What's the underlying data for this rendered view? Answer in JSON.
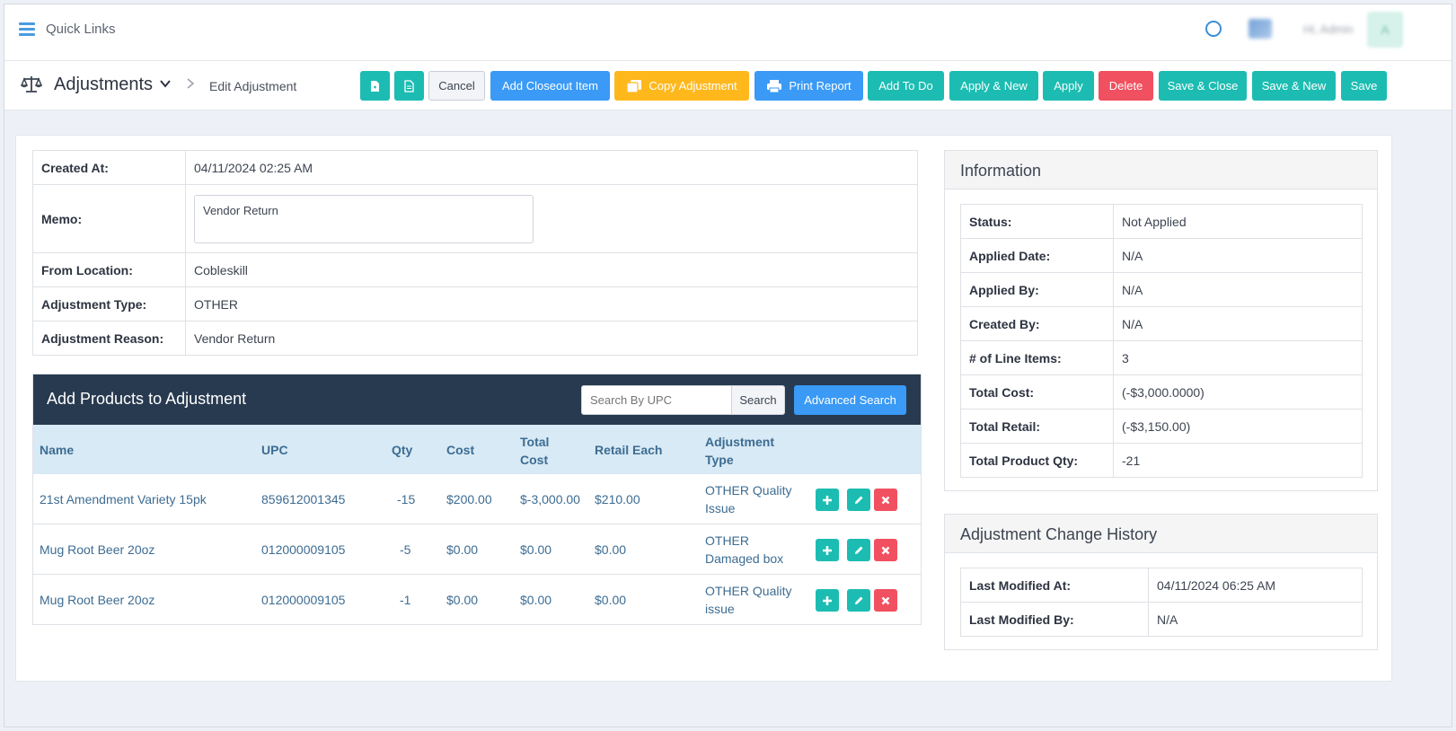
{
  "header": {
    "quick_links": "Quick Links",
    "user_label": "Hi, Admin",
    "avatar_initial": "A"
  },
  "toolbar": {
    "page_title": "Adjustments",
    "breadcrumb": "Edit Adjustment",
    "buttons": {
      "cancel": "Cancel",
      "add_closeout": "Add Closeout Item",
      "copy_adjustment": "Copy Adjustment",
      "print_report": "Print Report",
      "add_todo": "Add To Do",
      "apply_new": "Apply & New",
      "apply": "Apply",
      "delete": "Delete",
      "save_close": "Save & Close",
      "save_new": "Save & New",
      "save": "Save"
    }
  },
  "details": {
    "created_at_label": "Created At:",
    "created_at": "04/11/2024 02:25 AM",
    "memo_label": "Memo:",
    "memo": "Vendor Return",
    "from_location_label": "From Location:",
    "from_location": "Cobleskill",
    "adjustment_type_label": "Adjustment Type:",
    "adjustment_type": "OTHER",
    "adjustment_reason_label": "Adjustment Reason:",
    "adjustment_reason": "Vendor Return"
  },
  "products": {
    "title": "Add Products to Adjustment",
    "search_placeholder": "Search By UPC",
    "search_button": "Search",
    "advanced_search": "Advanced Search",
    "columns": [
      "Name",
      "UPC",
      "Qty",
      "Cost",
      "Total Cost",
      "Retail Each",
      "Adjustment Type"
    ],
    "rows": [
      {
        "name": "21st Amendment Variety 15pk",
        "upc": "859612001345",
        "qty": "-15",
        "cost": "$200.00",
        "total_cost": "$-3,000.00",
        "retail": "$210.00",
        "type1": "OTHER Quality",
        "type2": "Issue"
      },
      {
        "name": "Mug Root Beer 20oz",
        "upc": "012000009105",
        "qty": "-5",
        "cost": "$0.00",
        "total_cost": "$0.00",
        "retail": "$0.00",
        "type1": "OTHER",
        "type2": "Damaged box"
      },
      {
        "name": "Mug Root Beer 20oz",
        "upc": "012000009105",
        "qty": "-1",
        "cost": "$0.00",
        "total_cost": "$0.00",
        "retail": "$0.00",
        "type1": "OTHER Quality",
        "type2": "issue"
      }
    ]
  },
  "information": {
    "title": "Information",
    "status_label": "Status:",
    "status": "Not Applied",
    "applied_date_label": "Applied Date:",
    "applied_date": "N/A",
    "applied_by_label": "Applied By:",
    "applied_by": "N/A",
    "created_by_label": "Created By:",
    "created_by": "N/A",
    "line_items_label": "# of Line Items:",
    "line_items": "3",
    "total_cost_label": "Total Cost:",
    "total_cost": "(-$3,000.0000)",
    "total_retail_label": "Total Retail:",
    "total_retail": "(-$3,150.00)",
    "total_qty_label": "Total Product Qty:",
    "total_qty": "-21"
  },
  "history": {
    "title": "Adjustment Change History",
    "last_modified_at_label": "Last Modified At:",
    "last_modified_at": "04/11/2024 06:25 AM",
    "last_modified_by_label": "Last Modified By:",
    "last_modified_by": "N/A"
  },
  "colors": {
    "teal": "#1cbcb2",
    "blue": "#3a9af5",
    "yellow": "#ffb81c",
    "red": "#f0505f",
    "navy": "#283a50"
  }
}
